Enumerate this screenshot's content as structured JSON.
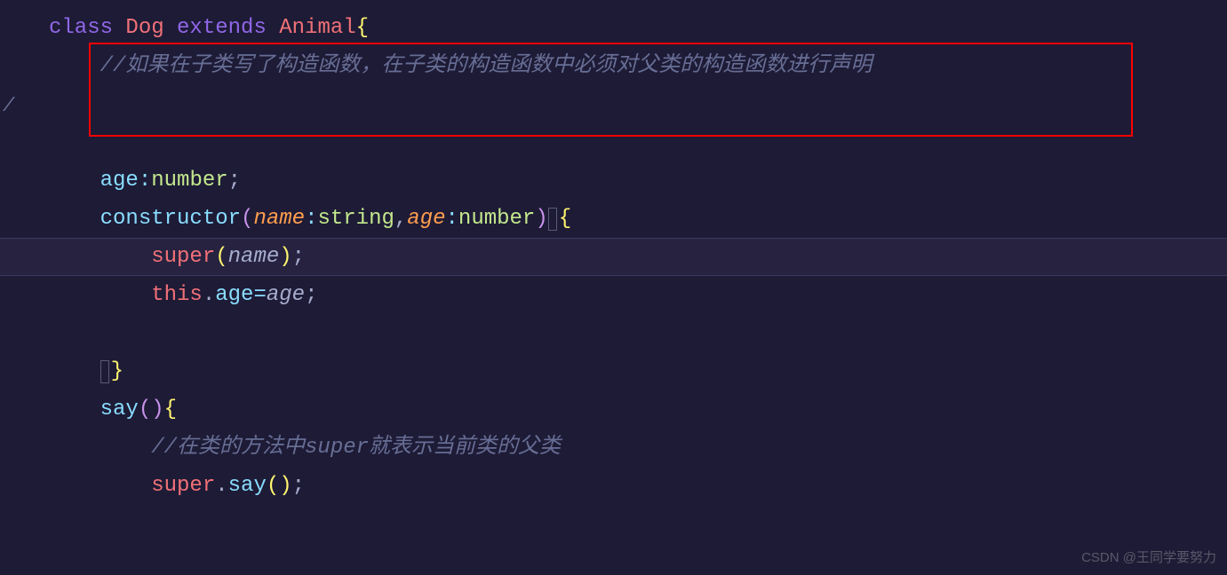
{
  "code": {
    "line1": {
      "class_kw": "class ",
      "class_name": "Dog ",
      "extends_kw": "extends ",
      "parent_class": "Animal",
      "brace": "{"
    },
    "line2": {
      "indent": "    ",
      "comment": "//如果在子类写了构造函数，在子类的构造函数中必须对父类的构造函数进行声明"
    },
    "line3": {
      "indent": "    ",
      "property": "age",
      "colon": ":",
      "type": "number",
      "semi": ";"
    },
    "line4": {
      "indent": "    ",
      "constructor": "constructor",
      "paren_open": "(",
      "param1_name": "name",
      "param1_colon": ":",
      "param1_type": "string",
      "comma": ",",
      "param2_name": "age",
      "param2_colon": ":",
      "param2_type": "number",
      "paren_close": ")",
      "brace": "{"
    },
    "line5": {
      "indent": "        ",
      "super_kw": "super",
      "paren_open": "(",
      "arg": "name",
      "paren_close": ")",
      "semi": ";"
    },
    "line6": {
      "indent": "        ",
      "this_kw": "this",
      "dot": ".",
      "property": "age",
      "operator": "=",
      "value": "age",
      "semi": ";"
    },
    "line7": {
      "indent": "    ",
      "brace": "}"
    },
    "line8": {
      "indent": "    ",
      "method": "say",
      "paren_open": "(",
      "paren_close": ")",
      "brace": "{"
    },
    "line9": {
      "indent": "        ",
      "comment": "//在类的方法中super就表示当前类的父类"
    },
    "line10": {
      "indent": "        ",
      "super_kw": "super",
      "dot": ".",
      "method": "say",
      "paren_open": "(",
      "paren_close": ")",
      "semi": ";"
    }
  },
  "gutter_slash": "/",
  "watermark": "CSDN @王同学要努力"
}
